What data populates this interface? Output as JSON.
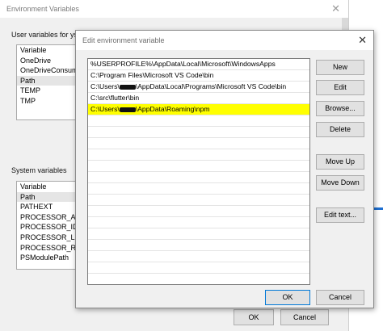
{
  "env_window": {
    "title": "Environment Variables",
    "user_group_label": "User variables for ysol",
    "user_list": {
      "header": "Variable",
      "rows": [
        "OneDrive",
        "OneDriveConsume",
        "Path",
        "TEMP",
        "TMP"
      ]
    },
    "system_group_label": "System variables",
    "system_list": {
      "header": "Variable",
      "rows": [
        "Path",
        "PATHEXT",
        "PROCESSOR_ARCH",
        "PROCESSOR_IDENT",
        "PROCESSOR_LEVEL",
        "PROCESSOR_REVIS",
        "PSModulePath"
      ]
    },
    "ok_label": "OK",
    "cancel_label": "Cancel"
  },
  "dialog": {
    "title": "Edit environment variable",
    "entries": [
      "%USERPROFILE%\\AppData\\Local\\Microsoft\\WindowsApps",
      "C:\\Program Files\\Microsoft VS Code\\bin",
      "C:\\Users\\",
      "\\AppData\\Local\\Programs\\Microsoft VS Code\\bin",
      "C:\\src\\flutter\\bin",
      "C:\\Users\\",
      "\\AppData\\Roaming\\npm"
    ],
    "buttons": {
      "new": "New",
      "edit": "Edit",
      "browse": "Browse...",
      "delete": "Delete",
      "move_up": "Move Up",
      "move_down": "Move Down",
      "edit_text": "Edit text...",
      "ok": "OK",
      "cancel": "Cancel"
    },
    "highlight_color": "#ffff00"
  }
}
